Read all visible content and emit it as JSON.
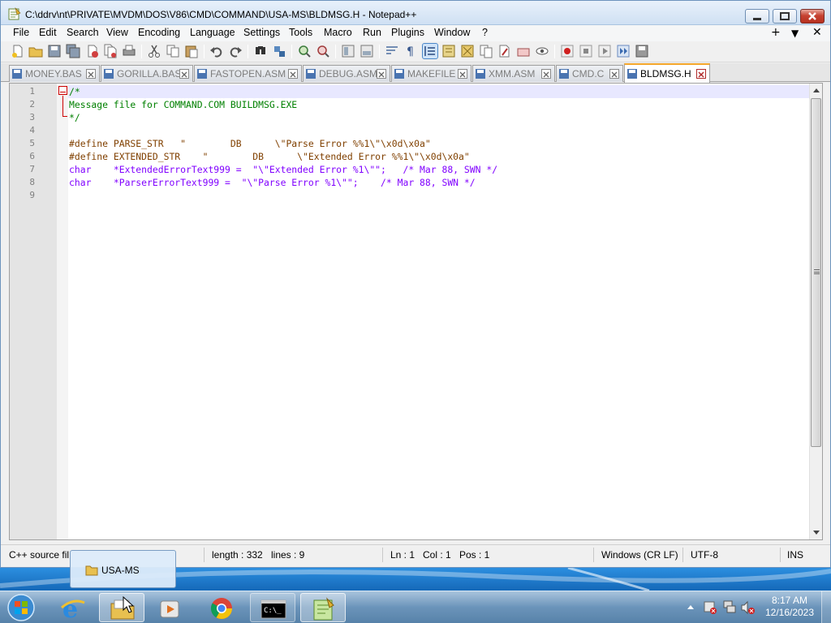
{
  "window": {
    "title": "C:\\ddrv\\nt\\PRIVATE\\MVDM\\DOS\\V86\\CMD\\COMMAND\\USA-MS\\BLDMSG.H - Notepad++"
  },
  "menu": {
    "items": [
      "File",
      "Edit",
      "Search",
      "View",
      "Encoding",
      "Language",
      "Settings",
      "Tools",
      "Macro",
      "Run",
      "Plugins",
      "Window",
      "?"
    ],
    "right": [
      "+",
      "▼",
      "✕"
    ]
  },
  "tabs": [
    {
      "label": "MONEY.BAS",
      "active": false
    },
    {
      "label": "GORILLA.BAS",
      "active": false
    },
    {
      "label": "FASTOPEN.ASM",
      "active": false
    },
    {
      "label": "DEBUG.ASM",
      "active": false
    },
    {
      "label": "MAKEFILE",
      "active": false
    },
    {
      "label": "XMM.ASM",
      "active": false
    },
    {
      "label": "CMD.C",
      "active": false
    },
    {
      "label": "BLDMSG.H",
      "active": true
    }
  ],
  "editor": {
    "lines": [
      {
        "num": "1",
        "text": "/*"
      },
      {
        "num": "2",
        "text": "Message file for COMMAND.COM BUILDMSG.EXE"
      },
      {
        "num": "3",
        "text": "*/"
      },
      {
        "num": "4",
        "text": ""
      },
      {
        "num": "5",
        "text": "#define PARSE_STR   \"        DB      \\\"Parse Error %%1\\\"\\x0d\\x0a\""
      },
      {
        "num": "6",
        "text": "#define EXTENDED_STR    \"        DB      \\\"Extended Error %%1\\\"\\x0d\\x0a\""
      },
      {
        "num": "7",
        "text": "char    *ExtendedErrorText999 =  \"\\\"Extended Error %1\\\"\";   /* Mar 88, SWN */"
      },
      {
        "num": "8",
        "text": "char    *ParserErrorText999 =  \"\\\"Parse Error %1\\\"\";    /* Mar 88, SWN */"
      },
      {
        "num": "9",
        "text": ""
      }
    ]
  },
  "status": {
    "filetype": "C++ source fil",
    "length": "length : 332",
    "lines": "lines : 9",
    "ln": "Ln : 1",
    "col": "Col : 1",
    "pos": "Pos : 1",
    "eol": "Windows (CR LF)",
    "encoding": "UTF-8",
    "mode": "INS"
  },
  "popup": {
    "label": "USA-MS"
  },
  "clock": {
    "time": "8:17 AM",
    "date": "12/16/2023"
  },
  "colors": {
    "comment": "#008000",
    "preprocessor": "#804000",
    "type": "#8000ff",
    "string": "#808080",
    "active_tab_accent": "#f4a62a"
  }
}
